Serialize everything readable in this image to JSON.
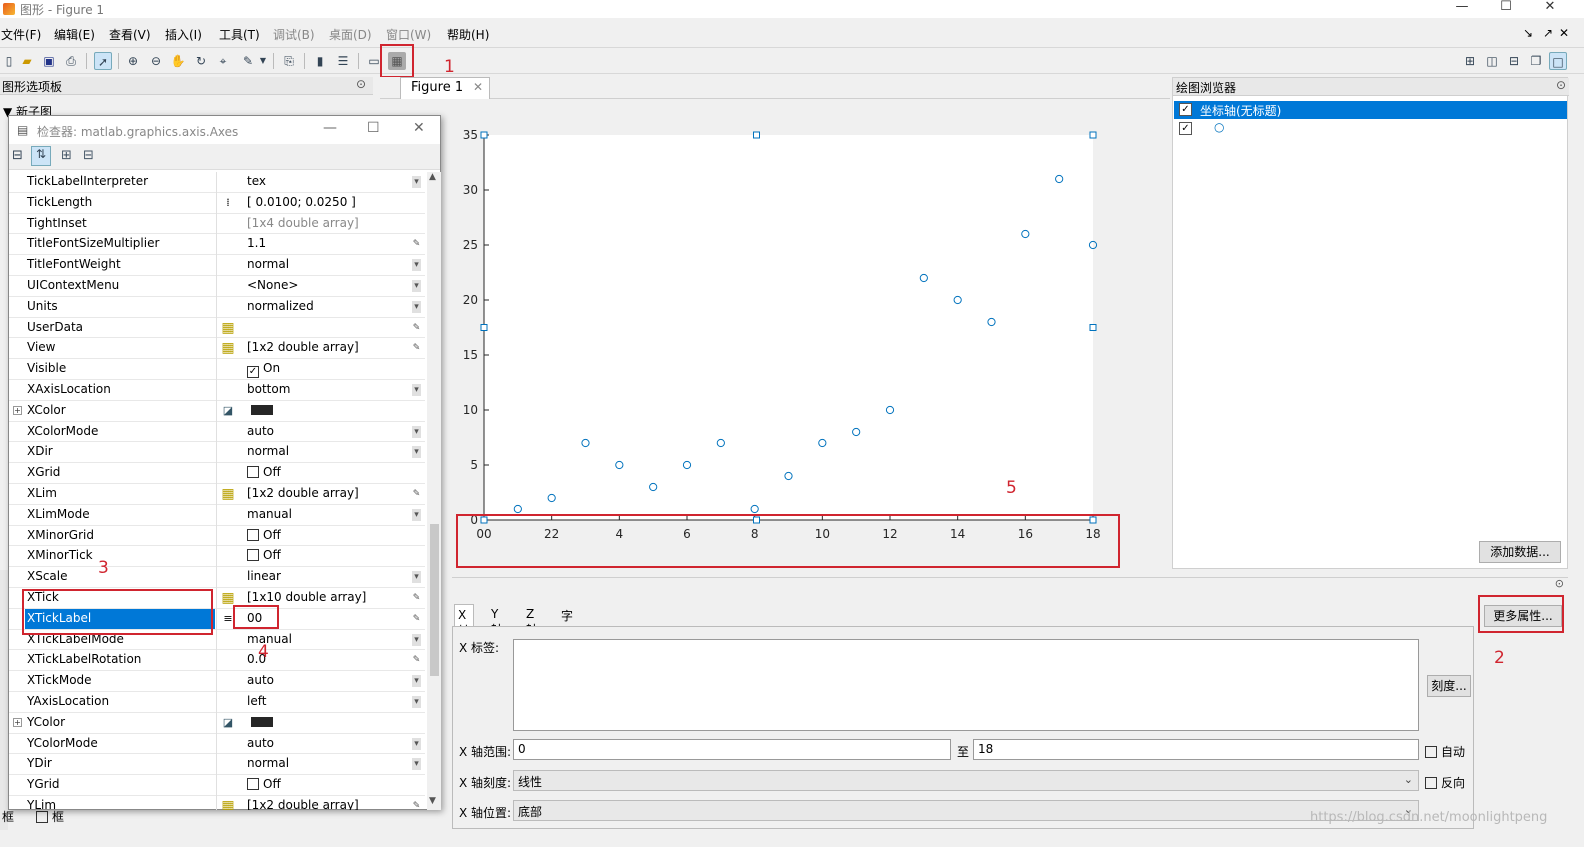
{
  "window": {
    "title": "图形 - Figure 1",
    "minimize": "—",
    "maximize": "☐",
    "close": "✕"
  },
  "menubar": [
    "文件(F)",
    "编辑(E)",
    "查看(V)",
    "插入(I)",
    "工具(T)",
    "调试(B)",
    "桌面(D)",
    "窗口(W)",
    "帮助(H)"
  ],
  "menubar_right": [
    "↘",
    "↗",
    "✕"
  ],
  "palette": {
    "title": "图形选项板",
    "subsection": "▼ 新子图"
  },
  "figure_tab": {
    "label": "Figure 1",
    "close": "✕"
  },
  "inspector": {
    "title": "检查器:  matlab.graphics.axis.Axes",
    "rows": [
      {
        "name": "TickLabelInterpreter",
        "value": "tex",
        "ctl": "dd"
      },
      {
        "name": "TickLength",
        "value": "[ 0.0100; 0.0250 ]",
        "icon": "matrix"
      },
      {
        "name": "TightInset",
        "value": "[1x4  double array]",
        "gray": true
      },
      {
        "name": "TitleFontSizeMultiplier",
        "value": "1.1",
        "ctl": "pen"
      },
      {
        "name": "TitleFontWeight",
        "value": "normal",
        "ctl": "dd"
      },
      {
        "name": "UIContextMenu",
        "value": "<None>",
        "ctl": "dd"
      },
      {
        "name": "Units",
        "value": "normalized",
        "ctl": "dd"
      },
      {
        "name": "UserData",
        "value": "",
        "icon": "grid",
        "ctl": "pen"
      },
      {
        "name": "View",
        "value": "[1x2  double array]",
        "icon": "grid",
        "ctl": "pen"
      },
      {
        "name": "Visible",
        "value": "On",
        "check": true
      },
      {
        "name": "XAxisLocation",
        "value": "bottom",
        "ctl": "dd"
      },
      {
        "name": "XColor",
        "value": "",
        "plus": true,
        "icon": "bucket",
        "swatch": true
      },
      {
        "name": "XColorMode",
        "value": "auto",
        "ctl": "dd"
      },
      {
        "name": "XDir",
        "value": "normal",
        "ctl": "dd"
      },
      {
        "name": "XGrid",
        "value": "Off",
        "check": false
      },
      {
        "name": "XLim",
        "value": "[1x2  double array]",
        "icon": "grid",
        "ctl": "pen"
      },
      {
        "name": "XLimMode",
        "value": "manual",
        "ctl": "dd"
      },
      {
        "name": "XMinorGrid",
        "value": "Off",
        "check": false
      },
      {
        "name": "XMinorTick",
        "value": "Off",
        "check": false
      },
      {
        "name": "XScale",
        "value": "linear",
        "ctl": "dd"
      },
      {
        "name": "XTick",
        "value": "[1x10  double array]",
        "icon": "grid",
        "ctl": "pen"
      },
      {
        "name": "XTickLabel",
        "value": "00",
        "icon": "list",
        "ctl": "pen",
        "selected": true
      },
      {
        "name": "XTickLabelMode",
        "value": "manual",
        "ctl": "dd"
      },
      {
        "name": "XTickLabelRotation",
        "value": "0.0",
        "ctl": "pen"
      },
      {
        "name": "XTickMode",
        "value": "auto",
        "ctl": "dd"
      },
      {
        "name": "YAxisLocation",
        "value": "left",
        "ctl": "dd"
      },
      {
        "name": "YColor",
        "value": "",
        "plus": true,
        "icon": "bucket",
        "swatch": true
      },
      {
        "name": "YColorMode",
        "value": "auto",
        "ctl": "dd"
      },
      {
        "name": "YDir",
        "value": "normal",
        "ctl": "dd"
      },
      {
        "name": "YGrid",
        "value": "Off",
        "check": false
      },
      {
        "name": "YLim",
        "value": "[1x2  double array]",
        "icon": "grid",
        "ctl": "pen"
      }
    ]
  },
  "chart_data": {
    "type": "scatter",
    "x": [
      1,
      2,
      3,
      4,
      5,
      6,
      7,
      8,
      9,
      10,
      11,
      12,
      13,
      14,
      15,
      16,
      17,
      18
    ],
    "y": [
      1,
      2,
      7,
      5,
      3,
      5,
      7,
      1,
      4,
      7,
      8,
      10,
      22,
      20,
      18,
      26,
      31,
      25
    ],
    "xlim": [
      0,
      18
    ],
    "ylim": [
      0,
      35
    ],
    "xtick_labels": [
      "00",
      "22",
      "4",
      "6",
      "8",
      "10",
      "12",
      "14",
      "16",
      "18"
    ],
    "ytick_labels": [
      "0",
      "5",
      "10",
      "15",
      "20",
      "25",
      "30",
      "35"
    ],
    "marker": "circle",
    "color": "#0072bd",
    "grid": false
  },
  "plot_browser": {
    "title": "绘图浏览器",
    "item1": "坐标轴(无标题)",
    "item2_marker": "○",
    "add_data": "添加数据..."
  },
  "property_editor": {
    "tabs": [
      "X 轴",
      "Y 轴",
      "Z 轴",
      "字体"
    ],
    "x_label_caption": "X 标签:",
    "ticks_button": "刻度...",
    "x_range_caption": "X 轴范围:",
    "x_min": "0",
    "to": "至",
    "x_max": "18",
    "auto": "自动",
    "x_scale_caption": "X 轴刻度:",
    "x_scale": "线性",
    "reverse": "反向",
    "x_location_caption": "X 轴位置:",
    "x_location": "底部",
    "more_props": "更多属性..."
  },
  "annotations": [
    "1",
    "2",
    "3",
    "4",
    "5"
  ],
  "watermark": "https://blog.csdn.net/moonlightpeng",
  "status_frame": "框"
}
